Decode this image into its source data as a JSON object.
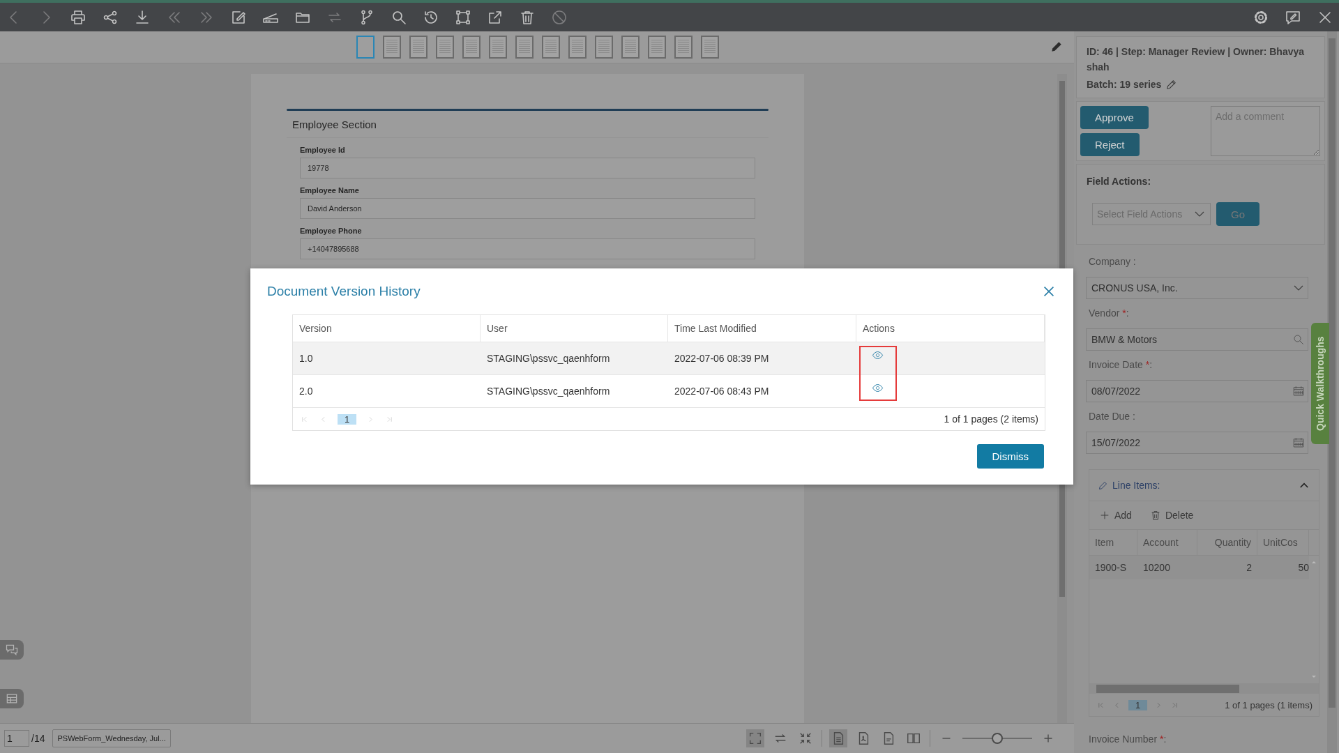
{
  "toolbar": {
    "tools": [
      {
        "kind": "back",
        "disabled": true
      },
      {
        "kind": "forward",
        "disabled": true
      },
      {
        "kind": "print",
        "disabled": false
      },
      {
        "kind": "share",
        "disabled": false
      },
      {
        "kind": "download",
        "disabled": false
      },
      {
        "kind": "first",
        "disabled": true
      },
      {
        "kind": "last",
        "disabled": true
      },
      {
        "kind": "edit",
        "disabled": false
      },
      {
        "kind": "scan",
        "disabled": false
      },
      {
        "kind": "folder",
        "disabled": false
      },
      {
        "kind": "swap",
        "disabled": true
      },
      {
        "kind": "branch",
        "disabled": false
      },
      {
        "kind": "search",
        "disabled": false
      },
      {
        "kind": "history",
        "disabled": false
      },
      {
        "kind": "workflow",
        "disabled": false
      },
      {
        "kind": "export",
        "disabled": false
      },
      {
        "kind": "delete",
        "disabled": false
      },
      {
        "kind": "ban",
        "disabled": true
      }
    ]
  },
  "thumbnails": [
    {
      "selected": true
    },
    {
      "selected": false
    },
    {
      "selected": false
    },
    {
      "selected": false
    },
    {
      "selected": false
    },
    {
      "selected": false
    },
    {
      "selected": false
    },
    {
      "selected": false
    },
    {
      "selected": false
    },
    {
      "selected": false
    },
    {
      "selected": false
    },
    {
      "selected": false
    },
    {
      "selected": false
    },
    {
      "selected": false
    }
  ],
  "document": {
    "section_title": "Employee Section",
    "fields": [
      {
        "label": "Employee Id",
        "value": "19778"
      },
      {
        "label": "Employee Name",
        "value": "David Anderson"
      },
      {
        "label": "Employee Phone",
        "value": "+14047895688"
      }
    ]
  },
  "bottom_bar": {
    "page": "1",
    "page_count": "/14",
    "file_name": "PSWebForm_Wednesday, Jul...",
    "zoom_slider": {
      "level": 0.5
    }
  },
  "dialog": {
    "title": "Document Version History",
    "columns": [
      "Version",
      "User",
      "Time Last Modified",
      "Actions"
    ],
    "rows": [
      {
        "version": "1.0",
        "user": "STAGING\\pssvc_qaenhform",
        "time": "2022-07-06 08:39 PM",
        "hovered": true
      },
      {
        "version": "2.0",
        "user": "STAGING\\pssvc_qaenhform",
        "time": "2022-07-06 08:43 PM",
        "hovered": false
      }
    ],
    "actions_highlighted": true,
    "pager": {
      "pages": [
        {
          "label": "1",
          "selected": true
        }
      ],
      "summary": "1 of 1 pages (2 items)"
    },
    "dismiss": "Dismiss"
  },
  "panel": {
    "header": "ID: 46 | Step: Manager Review | Owner: Bhavya shah",
    "batch": "Batch: 19 series",
    "approve": "Approve",
    "reject": "Reject",
    "comment_placeholder": "Add a comment",
    "field_actions": {
      "label": "Field Actions:",
      "placeholder": "Select Field Actions",
      "go": "Go"
    },
    "fields": [
      {
        "kind": "dropdown",
        "label": "Company :",
        "value": "CRONUS USA, Inc."
      },
      {
        "kind": "lookup",
        "label": "Vendor ",
        "required_mark": "*",
        "label_end": ":",
        "value": "BMW & Motors"
      },
      {
        "kind": "date",
        "label": "Invoice Date ",
        "required_mark": "*",
        "label_end": ":",
        "value": "08/07/2022"
      },
      {
        "kind": "date",
        "label": "Date Due :",
        "value": "15/07/2022"
      }
    ],
    "line_items": {
      "title": "Line Items:",
      "expanded": true,
      "add": "Add",
      "delete": "Delete",
      "columns": [
        "Item",
        "Account",
        "Quantity",
        "UnitCos"
      ],
      "rows": [
        {
          "cells": [
            "1900-S",
            "10200",
            "2",
            "50"
          ],
          "selected": true
        }
      ],
      "pager": {
        "pages": [
          {
            "label": "1",
            "selected": true
          }
        ],
        "summary": "1 of 1 pages (1 items)"
      }
    },
    "last_field": {
      "label": "Invoice Number ",
      "required_mark": "*",
      "label_end": ":"
    },
    "walkthrough_tab": "Quick Walkthroughs"
  }
}
